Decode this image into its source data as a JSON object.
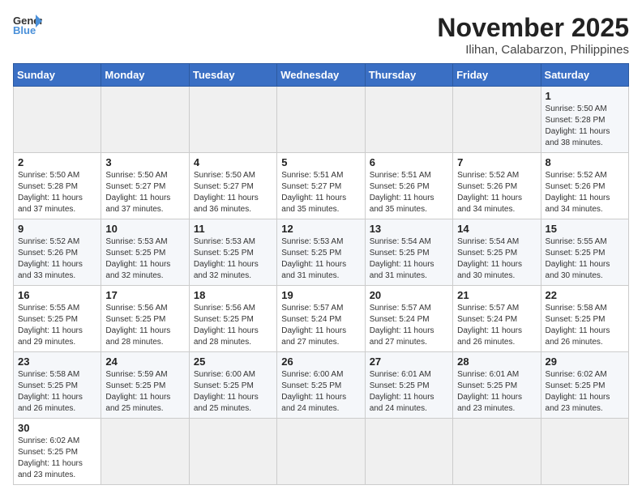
{
  "header": {
    "logo_general": "General",
    "logo_blue": "Blue",
    "title": "November 2025",
    "subtitle": "Ilihan, Calabarzon, Philippines"
  },
  "weekdays": [
    "Sunday",
    "Monday",
    "Tuesday",
    "Wednesday",
    "Thursday",
    "Friday",
    "Saturday"
  ],
  "weeks": [
    [
      {
        "day": "",
        "sunrise": "",
        "sunset": "",
        "daylight": "",
        "empty": true
      },
      {
        "day": "",
        "sunrise": "",
        "sunset": "",
        "daylight": "",
        "empty": true
      },
      {
        "day": "",
        "sunrise": "",
        "sunset": "",
        "daylight": "",
        "empty": true
      },
      {
        "day": "",
        "sunrise": "",
        "sunset": "",
        "daylight": "",
        "empty": true
      },
      {
        "day": "",
        "sunrise": "",
        "sunset": "",
        "daylight": "",
        "empty": true
      },
      {
        "day": "",
        "sunrise": "",
        "sunset": "",
        "daylight": "",
        "empty": true
      },
      {
        "day": "1",
        "sunrise": "5:50 AM",
        "sunset": "5:28 PM",
        "daylight": "11 hours and 38 minutes.",
        "empty": false
      }
    ],
    [
      {
        "day": "2",
        "sunrise": "5:50 AM",
        "sunset": "5:28 PM",
        "daylight": "11 hours and 37 minutes.",
        "empty": false
      },
      {
        "day": "3",
        "sunrise": "5:50 AM",
        "sunset": "5:27 PM",
        "daylight": "11 hours and 37 minutes.",
        "empty": false
      },
      {
        "day": "4",
        "sunrise": "5:50 AM",
        "sunset": "5:27 PM",
        "daylight": "11 hours and 36 minutes.",
        "empty": false
      },
      {
        "day": "5",
        "sunrise": "5:51 AM",
        "sunset": "5:27 PM",
        "daylight": "11 hours and 35 minutes.",
        "empty": false
      },
      {
        "day": "6",
        "sunrise": "5:51 AM",
        "sunset": "5:26 PM",
        "daylight": "11 hours and 35 minutes.",
        "empty": false
      },
      {
        "day": "7",
        "sunrise": "5:52 AM",
        "sunset": "5:26 PM",
        "daylight": "11 hours and 34 minutes.",
        "empty": false
      },
      {
        "day": "8",
        "sunrise": "5:52 AM",
        "sunset": "5:26 PM",
        "daylight": "11 hours and 34 minutes.",
        "empty": false
      }
    ],
    [
      {
        "day": "9",
        "sunrise": "5:52 AM",
        "sunset": "5:26 PM",
        "daylight": "11 hours and 33 minutes.",
        "empty": false
      },
      {
        "day": "10",
        "sunrise": "5:53 AM",
        "sunset": "5:25 PM",
        "daylight": "11 hours and 32 minutes.",
        "empty": false
      },
      {
        "day": "11",
        "sunrise": "5:53 AM",
        "sunset": "5:25 PM",
        "daylight": "11 hours and 32 minutes.",
        "empty": false
      },
      {
        "day": "12",
        "sunrise": "5:53 AM",
        "sunset": "5:25 PM",
        "daylight": "11 hours and 31 minutes.",
        "empty": false
      },
      {
        "day": "13",
        "sunrise": "5:54 AM",
        "sunset": "5:25 PM",
        "daylight": "11 hours and 31 minutes.",
        "empty": false
      },
      {
        "day": "14",
        "sunrise": "5:54 AM",
        "sunset": "5:25 PM",
        "daylight": "11 hours and 30 minutes.",
        "empty": false
      },
      {
        "day": "15",
        "sunrise": "5:55 AM",
        "sunset": "5:25 PM",
        "daylight": "11 hours and 30 minutes.",
        "empty": false
      }
    ],
    [
      {
        "day": "16",
        "sunrise": "5:55 AM",
        "sunset": "5:25 PM",
        "daylight": "11 hours and 29 minutes.",
        "empty": false
      },
      {
        "day": "17",
        "sunrise": "5:56 AM",
        "sunset": "5:25 PM",
        "daylight": "11 hours and 28 minutes.",
        "empty": false
      },
      {
        "day": "18",
        "sunrise": "5:56 AM",
        "sunset": "5:25 PM",
        "daylight": "11 hours and 28 minutes.",
        "empty": false
      },
      {
        "day": "19",
        "sunrise": "5:57 AM",
        "sunset": "5:24 PM",
        "daylight": "11 hours and 27 minutes.",
        "empty": false
      },
      {
        "day": "20",
        "sunrise": "5:57 AM",
        "sunset": "5:24 PM",
        "daylight": "11 hours and 27 minutes.",
        "empty": false
      },
      {
        "day": "21",
        "sunrise": "5:57 AM",
        "sunset": "5:24 PM",
        "daylight": "11 hours and 26 minutes.",
        "empty": false
      },
      {
        "day": "22",
        "sunrise": "5:58 AM",
        "sunset": "5:25 PM",
        "daylight": "11 hours and 26 minutes.",
        "empty": false
      }
    ],
    [
      {
        "day": "23",
        "sunrise": "5:58 AM",
        "sunset": "5:25 PM",
        "daylight": "11 hours and 26 minutes.",
        "empty": false
      },
      {
        "day": "24",
        "sunrise": "5:59 AM",
        "sunset": "5:25 PM",
        "daylight": "11 hours and 25 minutes.",
        "empty": false
      },
      {
        "day": "25",
        "sunrise": "6:00 AM",
        "sunset": "5:25 PM",
        "daylight": "11 hours and 25 minutes.",
        "empty": false
      },
      {
        "day": "26",
        "sunrise": "6:00 AM",
        "sunset": "5:25 PM",
        "daylight": "11 hours and 24 minutes.",
        "empty": false
      },
      {
        "day": "27",
        "sunrise": "6:01 AM",
        "sunset": "5:25 PM",
        "daylight": "11 hours and 24 minutes.",
        "empty": false
      },
      {
        "day": "28",
        "sunrise": "6:01 AM",
        "sunset": "5:25 PM",
        "daylight": "11 hours and 23 minutes.",
        "empty": false
      },
      {
        "day": "29",
        "sunrise": "6:02 AM",
        "sunset": "5:25 PM",
        "daylight": "11 hours and 23 minutes.",
        "empty": false
      }
    ],
    [
      {
        "day": "30",
        "sunrise": "6:02 AM",
        "sunset": "5:25 PM",
        "daylight": "11 hours and 23 minutes.",
        "empty": false
      },
      {
        "day": "",
        "sunrise": "",
        "sunset": "",
        "daylight": "",
        "empty": true
      },
      {
        "day": "",
        "sunrise": "",
        "sunset": "",
        "daylight": "",
        "empty": true
      },
      {
        "day": "",
        "sunrise": "",
        "sunset": "",
        "daylight": "",
        "empty": true
      },
      {
        "day": "",
        "sunrise": "",
        "sunset": "",
        "daylight": "",
        "empty": true
      },
      {
        "day": "",
        "sunrise": "",
        "sunset": "",
        "daylight": "",
        "empty": true
      },
      {
        "day": "",
        "sunrise": "",
        "sunset": "",
        "daylight": "",
        "empty": true
      }
    ]
  ],
  "labels": {
    "sunrise": "Sunrise:",
    "sunset": "Sunset:",
    "daylight": "Daylight:"
  }
}
